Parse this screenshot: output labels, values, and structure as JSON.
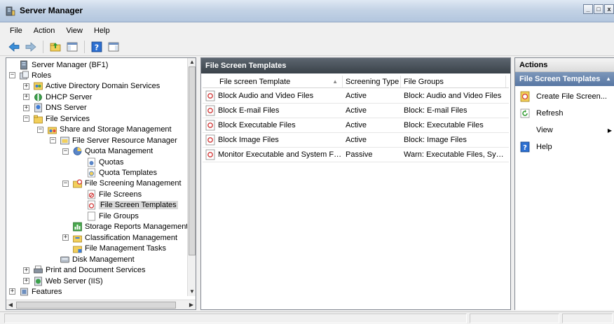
{
  "window": {
    "title": "Server Manager",
    "buttons": [
      "_",
      "□",
      "x"
    ]
  },
  "menu": [
    "File",
    "Action",
    "View",
    "Help"
  ],
  "tree": [
    {
      "label": "Server Manager (BF1)",
      "level": 0,
      "expander": "",
      "icon": "server-icon"
    },
    {
      "label": "Roles",
      "level": 0,
      "expander": "−",
      "icon": "roles-icon"
    },
    {
      "label": "Active Directory Domain Services",
      "level": 1,
      "expander": "+",
      "icon": "ad-icon"
    },
    {
      "label": "DHCP Server",
      "level": 1,
      "expander": "+",
      "icon": "dhcp-icon"
    },
    {
      "label": "DNS Server",
      "level": 1,
      "expander": "+",
      "icon": "dns-icon"
    },
    {
      "label": "File Services",
      "level": 1,
      "expander": "−",
      "icon": "file-services-icon"
    },
    {
      "label": "Share and Storage Management",
      "level": 2,
      "expander": "−",
      "icon": "share-icon"
    },
    {
      "label": "File Server Resource Manager",
      "level": 3,
      "expander": "−",
      "icon": "fsrm-icon"
    },
    {
      "label": "Quota Management",
      "level": 4,
      "expander": "−",
      "icon": "quota-icon"
    },
    {
      "label": "Quotas",
      "level": 5,
      "expander": "",
      "icon": "quotas-icon"
    },
    {
      "label": "Quota Templates",
      "level": 5,
      "expander": "",
      "icon": "quota-templates-icon"
    },
    {
      "label": "File Screening Management",
      "level": 4,
      "expander": "−",
      "icon": "screening-icon"
    },
    {
      "label": "File Screens",
      "level": 5,
      "expander": "",
      "icon": "file-screens-icon"
    },
    {
      "label": "File Screen Templates",
      "level": 5,
      "expander": "",
      "icon": "screen-templates-icon",
      "selected": true
    },
    {
      "label": "File Groups",
      "level": 5,
      "expander": "",
      "icon": "file-groups-icon"
    },
    {
      "label": "Storage Reports Management",
      "level": 4,
      "expander": "",
      "icon": "reports-icon"
    },
    {
      "label": "Classification Management",
      "level": 4,
      "expander": "+",
      "icon": "classification-icon"
    },
    {
      "label": "File Management Tasks",
      "level": 4,
      "expander": "",
      "icon": "tasks-icon"
    },
    {
      "label": "Disk Management",
      "level": 3,
      "expander": "",
      "icon": "disk-icon"
    },
    {
      "label": "Print and Document Services",
      "level": 1,
      "expander": "+",
      "icon": "print-icon"
    },
    {
      "label": "Web Server (IIS)",
      "level": 1,
      "expander": "+",
      "icon": "web-icon"
    },
    {
      "label": "Features",
      "level": 0,
      "expander": "+",
      "icon": "features-icon"
    }
  ],
  "center": {
    "title": "File Screen Templates",
    "columns": [
      "File screen Template",
      "Screening Type",
      "File Groups"
    ],
    "rows": [
      {
        "template": "Block Audio and Video Files",
        "type": "Active",
        "groups": "Block: Audio and Video Files"
      },
      {
        "template": "Block E-mail Files",
        "type": "Active",
        "groups": "Block: E-mail Files"
      },
      {
        "template": "Block Executable Files",
        "type": "Active",
        "groups": "Block: Executable Files"
      },
      {
        "template": "Block Image Files",
        "type": "Active",
        "groups": "Block: Image Files"
      },
      {
        "template": "Monitor Executable and System Files",
        "type": "Passive",
        "groups": "Warn: Executable Files, Syst..."
      }
    ]
  },
  "actions": {
    "title": "Actions",
    "section": "File Screen Templates",
    "items": [
      {
        "label": "Create File Screen...",
        "icon": "create-icon"
      },
      {
        "label": "Refresh",
        "icon": "refresh-icon"
      },
      {
        "label": "View",
        "icon": "",
        "submenu": true
      },
      {
        "label": "Help",
        "icon": "help-icon"
      }
    ]
  },
  "colors": {
    "header_dark": "#3a4249",
    "actions_blue": "#5777a3",
    "selection": "#d9d9d9"
  }
}
